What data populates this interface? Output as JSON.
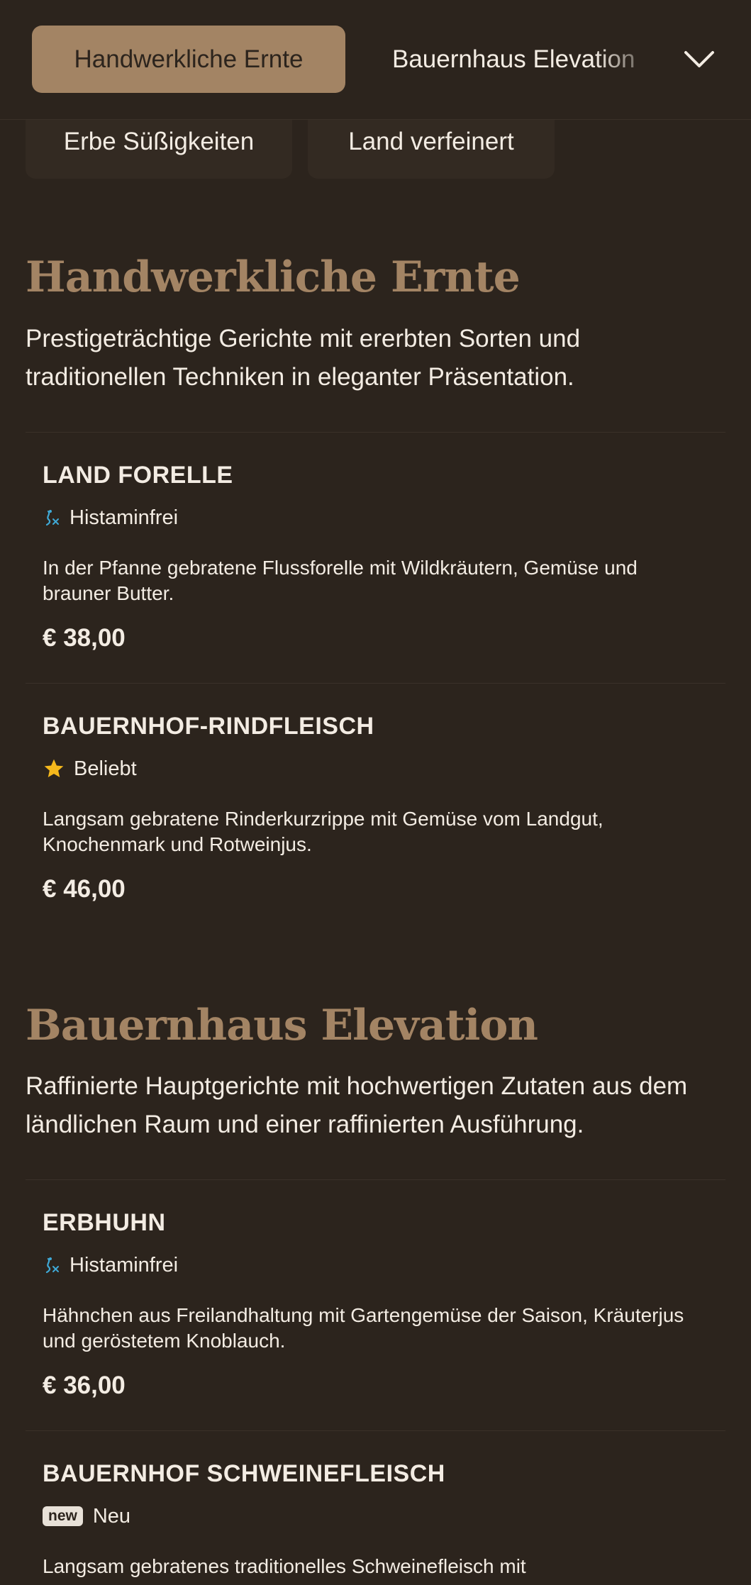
{
  "nav": {
    "active_category": "Handwerkliche Ernte",
    "next_category": "Bauernhaus Elevation",
    "chips": [
      "Erbe Süßigkeiten",
      "Land verfeinert"
    ]
  },
  "sections": [
    {
      "title": "Handwerkliche Ernte",
      "description": "Prestigeträchtige Gerichte mit ererbten Sorten und traditionellen Techniken in eleganter Präsentation.",
      "items": [
        {
          "name": "LAND FORELLE",
          "tag_icon": "histamine-free-icon",
          "tag": "Histaminfrei",
          "description": "In der Pfanne gebratene Flussforelle mit Wildkräutern, Gemüse und brauner Butter.",
          "price": "€ 38,00"
        },
        {
          "name": "BAUERNHOF-RINDFLEISCH",
          "tag_icon": "star-icon",
          "tag": "Beliebt",
          "description": "Langsam gebratene Rinderkurzrippe mit Gemüse vom Landgut, Knochenmark und Rotweinjus.",
          "price": "€ 46,00"
        }
      ]
    },
    {
      "title": "Bauernhaus Elevation",
      "description": "Raffinierte Hauptgerichte mit hochwertigen Zutaten aus dem ländlichen Raum und einer raffinierten Ausführung.",
      "items": [
        {
          "name": "ERBHUHN",
          "tag_icon": "histamine-free-icon",
          "tag": "Histaminfrei",
          "description": "Hähnchen aus Freilandhaltung mit Gartengemüse der Saison, Kräuterjus und geröstetem Knoblauch.",
          "price": "€ 36,00"
        },
        {
          "name": "BAUERNHOF SCHWEINEFLEISCH",
          "tag_icon": "new-badge-icon",
          "badge": "new",
          "tag": "Neu",
          "description": "Langsam gebratenes traditionelles Schweinefleisch mit"
        }
      ]
    }
  ],
  "colors": {
    "background": "#2c241d",
    "accent": "#a38464",
    "text": "#f3ece3",
    "chip": "#332a22",
    "histamine_icon": "#3fa9d6",
    "star": "#f5b81c"
  }
}
